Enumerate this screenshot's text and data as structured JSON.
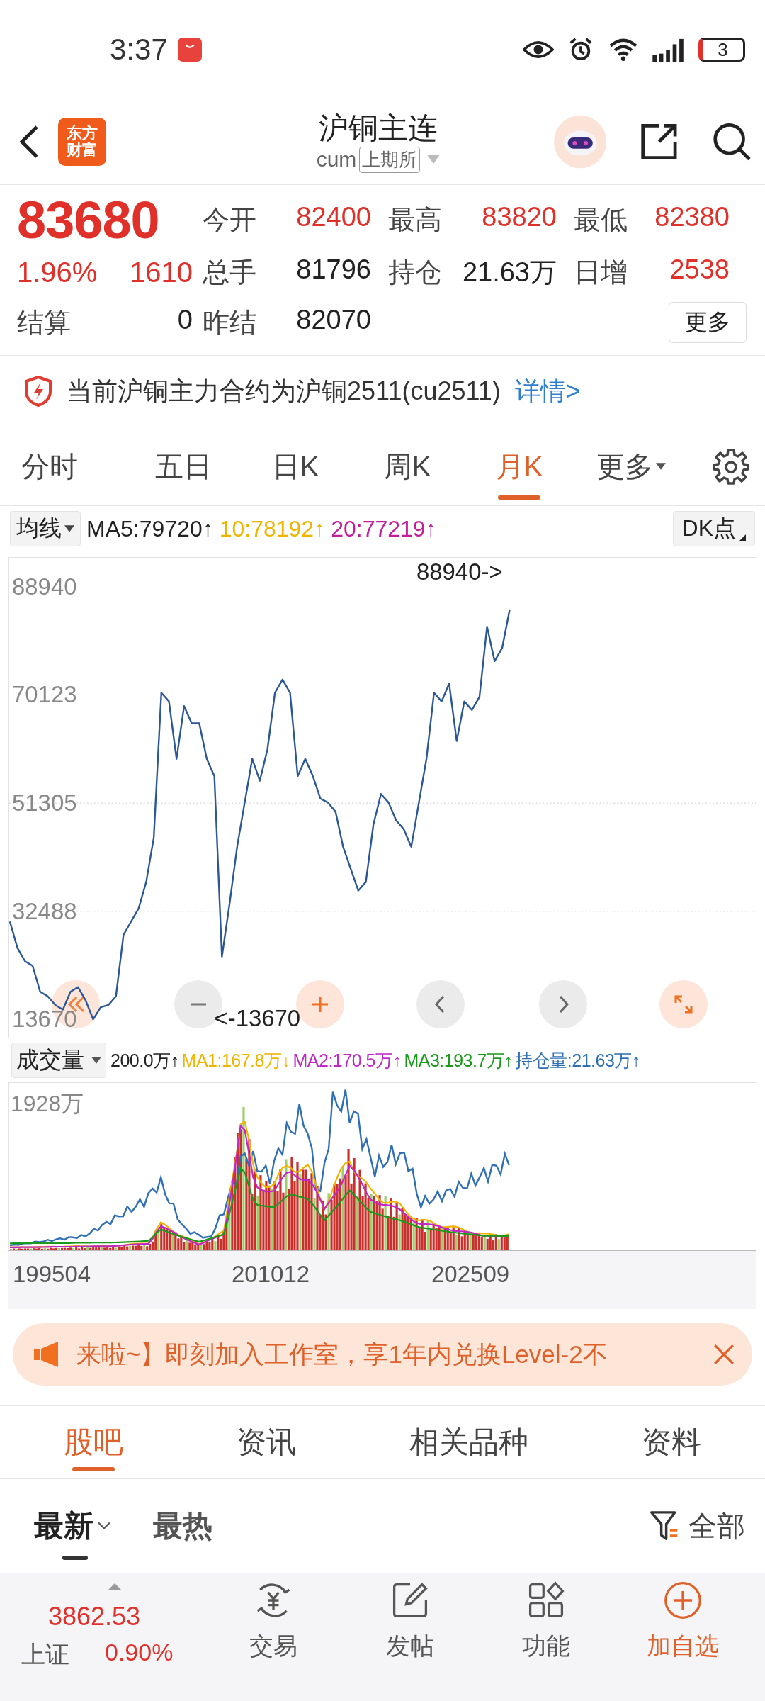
{
  "status_bar": {
    "time": "3:37",
    "battery": "3"
  },
  "header": {
    "logo_lines": [
      "东方",
      "财富"
    ],
    "title": "沪铜主连",
    "code": "cum",
    "exchange": "上期所"
  },
  "quote": {
    "price": "83680",
    "change_pct": "1.96%",
    "change": "1610",
    "settle_label": "结算",
    "settle": "0",
    "fields": [
      {
        "label": "今开",
        "value": "82400",
        "kind": "up"
      },
      {
        "label": "最高",
        "value": "83820",
        "kind": "up"
      },
      {
        "label": "最低",
        "value": "82380",
        "kind": "up"
      },
      {
        "label": "总手",
        "value": "81796",
        "kind": "plain"
      },
      {
        "label": "持仓",
        "value": "21.63万",
        "kind": "plain"
      },
      {
        "label": "日增",
        "value": "2538",
        "kind": "up"
      },
      {
        "label": "昨结",
        "value": "82070",
        "kind": "plain"
      }
    ],
    "more_button": "更多"
  },
  "notice": {
    "text": "当前沪铜主力合约为沪铜2511(cu2511)",
    "link": "详情>"
  },
  "period_tabs": [
    {
      "label": "分时",
      "selected": false,
      "kind": "plain"
    },
    {
      "label": "五日",
      "selected": false,
      "kind": "plain"
    },
    {
      "label": "日K",
      "selected": false,
      "kind": "plain"
    },
    {
      "label": "周K",
      "selected": false,
      "kind": "plain"
    },
    {
      "label": "月K",
      "selected": true,
      "kind": "plain"
    },
    {
      "label": "更多",
      "selected": false,
      "kind": "dropdown"
    }
  ],
  "indicator_bar": {
    "button": "均线",
    "values": [
      {
        "text": "MA5:79720↑",
        "color": "#222222"
      },
      {
        "text": "10:78192↑",
        "color": "#f0b400"
      },
      {
        "text": "20:77219↑",
        "color": "#c0209a"
      }
    ],
    "dk_button": "DK点"
  },
  "price_chart": {
    "chart_data": {
      "type": "line",
      "ylim": [
        10600,
        93900
      ],
      "grid": true,
      "yticks": [
        13670,
        32488,
        51305,
        70123,
        88940
      ],
      "series": [
        {
          "color": "#2b5797",
          "values": [
            30700,
            26100,
            23800,
            23000,
            18500,
            17700,
            16200,
            15400,
            18500,
            19300,
            17000,
            13700,
            15800,
            16200,
            17700,
            28400,
            30700,
            33000,
            37600,
            45300,
            70500,
            69000,
            59000,
            68200,
            65200,
            65200,
            59000,
            56000,
            24600,
            33800,
            43700,
            51400,
            59000,
            55200,
            60600,
            70500,
            72800,
            70500,
            56000,
            59000,
            56000,
            52100,
            51400,
            49800,
            43700,
            39900,
            36100,
            37600,
            47600,
            52900,
            51400,
            48300,
            46800,
            43700,
            51400,
            59000,
            70500,
            69000,
            72100,
            62100,
            69000,
            67500,
            69800,
            82000,
            76000,
            78300,
            85000
          ]
        }
      ],
      "annotations": [
        "88940->",
        "<-13670"
      ]
    }
  },
  "volume_bar": {
    "button": "成交量",
    "values": [
      {
        "text": "200.0万↑",
        "color": "#222222"
      },
      {
        "text": "MA1:167.8万↓",
        "color": "#f0b400"
      },
      {
        "text": "MA2:170.5万↑",
        "color": "#c026c8"
      },
      {
        "text": "MA3:193.7万↑",
        "color": "#1a9a1a"
      },
      {
        "text": "持仓量:21.63万↑",
        "color": "#2f6fb5"
      }
    ]
  },
  "volume_chart": {
    "top_label": "1928万",
    "x_labels": [
      "199504",
      "201012",
      "202509"
    ]
  },
  "banner": {
    "text": "来啦~】即刻加入工作室，享1年内兑换Level-2不"
  },
  "content_tabs": [
    {
      "label": "股吧",
      "selected": true
    },
    {
      "label": "资讯",
      "selected": false
    },
    {
      "label": "相关品种",
      "selected": false
    },
    {
      "label": "资料",
      "selected": false
    }
  ],
  "sort_tabs": [
    {
      "label": "最新",
      "selected": true,
      "kind": "dropdown"
    },
    {
      "label": "最热",
      "selected": false,
      "kind": "plain"
    }
  ],
  "filter": "全部",
  "bottom_nav": {
    "index_value": "3862.53",
    "index_name": "上证",
    "index_change": "0.90%",
    "items": [
      {
        "label": "交易",
        "kind": "trade"
      },
      {
        "label": "发帖",
        "kind": "post"
      },
      {
        "label": "功能",
        "kind": "apps"
      },
      {
        "label": "加自选",
        "kind": "add"
      }
    ]
  }
}
